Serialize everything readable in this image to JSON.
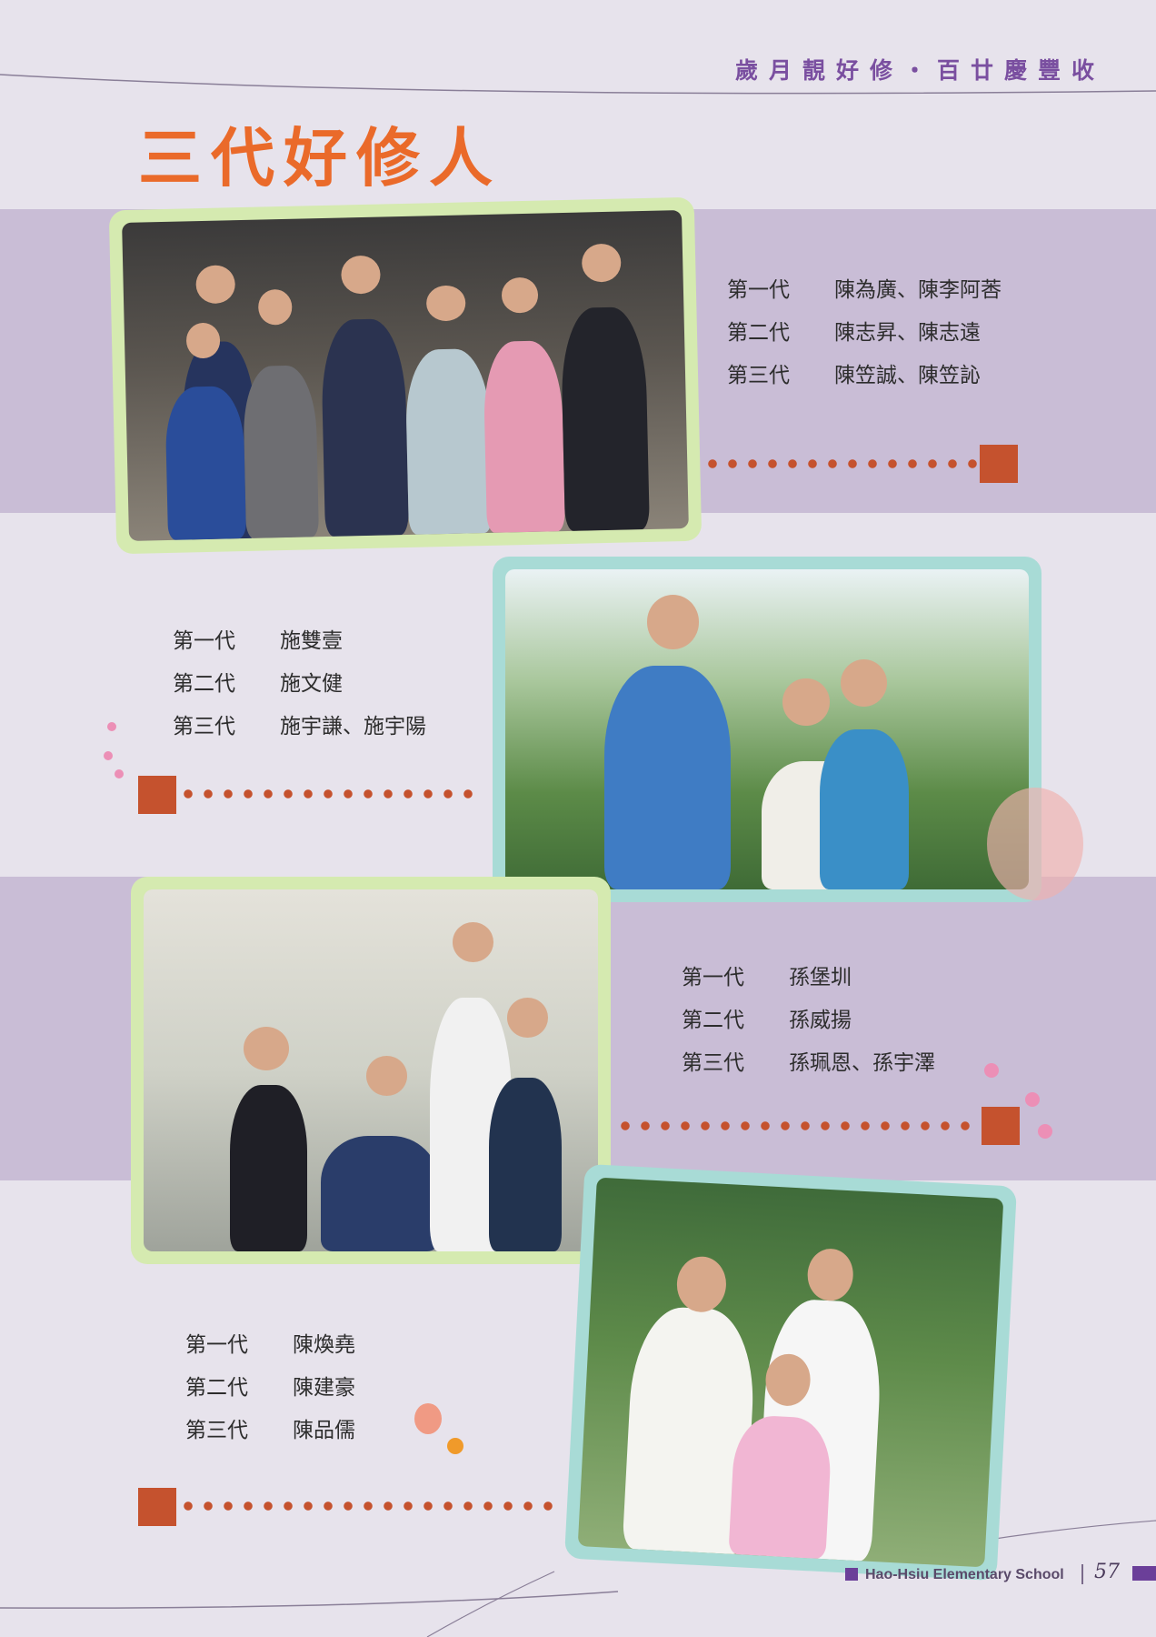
{
  "header": {
    "title": "歲月靚好修・百廿慶豐收"
  },
  "page_title": "三代好修人",
  "families": [
    {
      "rows": [
        {
          "gen": "第一代",
          "names": "陳為廣、陳李阿莕"
        },
        {
          "gen": "第二代",
          "names": "陳志昇、陳志遠"
        },
        {
          "gen": "第三代",
          "names": "陳笠誠、陳笠訫"
        }
      ]
    },
    {
      "rows": [
        {
          "gen": "第一代",
          "names": "施雙壹"
        },
        {
          "gen": "第二代",
          "names": "施文健"
        },
        {
          "gen": "第三代",
          "names": "施宇謙、施宇陽"
        }
      ]
    },
    {
      "rows": [
        {
          "gen": "第一代",
          "names": "孫堡圳"
        },
        {
          "gen": "第二代",
          "names": "孫威揚"
        },
        {
          "gen": "第三代",
          "names": "孫珮恩、孫宇澤"
        }
      ]
    },
    {
      "rows": [
        {
          "gen": "第一代",
          "names": "陳煥堯"
        },
        {
          "gen": "第二代",
          "names": "陳建豪"
        },
        {
          "gen": "第三代",
          "names": "陳品儒"
        }
      ]
    }
  ],
  "footer": {
    "school": "Hao-Hsiu Elementary School",
    "page_number": "57"
  },
  "colors": {
    "accent_orange": "#ea6a2a",
    "header_purple": "#7a4fa0",
    "band_lavender": "#c9bdd6",
    "rust_square": "#c5522e",
    "frame_green": "#d5eab0",
    "frame_teal": "#a8dbd6"
  }
}
